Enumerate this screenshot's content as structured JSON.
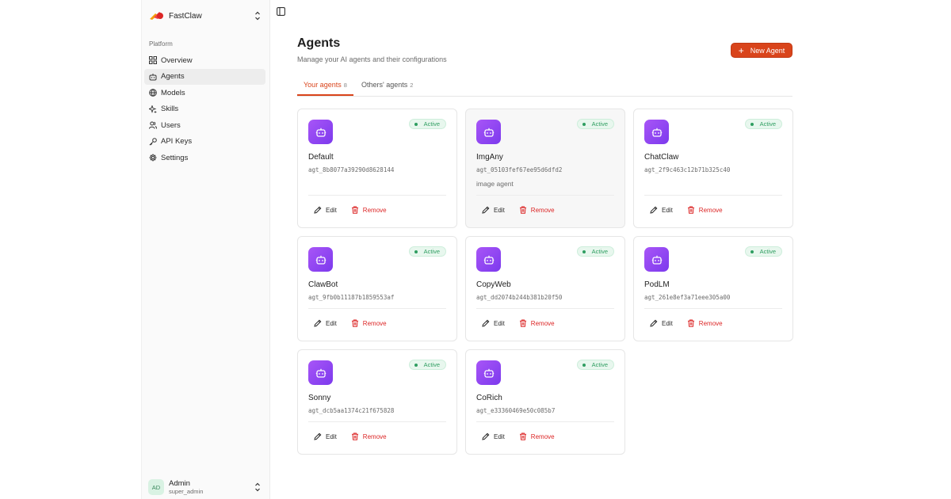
{
  "brand": {
    "name": "FastClaw"
  },
  "sidebar": {
    "section_label": "Platform",
    "items": [
      {
        "label": "Overview",
        "icon": "grid-icon",
        "active": false
      },
      {
        "label": "Agents",
        "icon": "bot-icon",
        "active": true
      },
      {
        "label": "Models",
        "icon": "globe-icon",
        "active": false
      },
      {
        "label": "Skills",
        "icon": "sparkle-icon",
        "active": false
      },
      {
        "label": "Users",
        "icon": "users-icon",
        "active": false
      },
      {
        "label": "API Keys",
        "icon": "key-icon",
        "active": false
      },
      {
        "label": "Settings",
        "icon": "gear-icon",
        "active": false
      }
    ]
  },
  "user": {
    "initials": "AD",
    "name": "Admin",
    "role": "super_admin"
  },
  "page": {
    "title": "Agents",
    "subtitle": "Manage your AI agents and their configurations",
    "new_agent_label": "New Agent"
  },
  "tabs": [
    {
      "label": "Your agents",
      "count": "8",
      "active": true
    },
    {
      "label": "Others' agents",
      "count": "2",
      "active": false
    }
  ],
  "colors": {
    "accent": "#d9441b",
    "status_green": "#2f9e61",
    "remove_red": "#dc2626",
    "icon_purple": "#8b5cf6"
  },
  "agents": [
    {
      "name": "Default",
      "id": "agt_8b8077a39290d8628144",
      "description": "",
      "status": "Active"
    },
    {
      "name": "ImgAny",
      "id": "agt_05103fef67ee95d6dfd2",
      "description": "image agent",
      "status": "Active"
    },
    {
      "name": "ChatClaw",
      "id": "agt_2f9c463c12b71b325c40",
      "description": "",
      "status": "Active"
    },
    {
      "name": "ClawBot",
      "id": "agt_9fb0b11187b1859553af",
      "description": "",
      "status": "Active"
    },
    {
      "name": "CopyWeb",
      "id": "agt_dd2074b244b381b20f50",
      "description": "",
      "status": "Active"
    },
    {
      "name": "PodLM",
      "id": "agt_261e8ef3a71eee305a00",
      "description": "",
      "status": "Active"
    },
    {
      "name": "Sonny",
      "id": "agt_dcb5aa1374c21f675828",
      "description": "",
      "status": "Active"
    },
    {
      "name": "CoRich",
      "id": "agt_e33360469e50c085b7",
      "description": "",
      "status": "Active"
    }
  ],
  "card_actions": {
    "edit_label": "Edit",
    "remove_label": "Remove"
  }
}
